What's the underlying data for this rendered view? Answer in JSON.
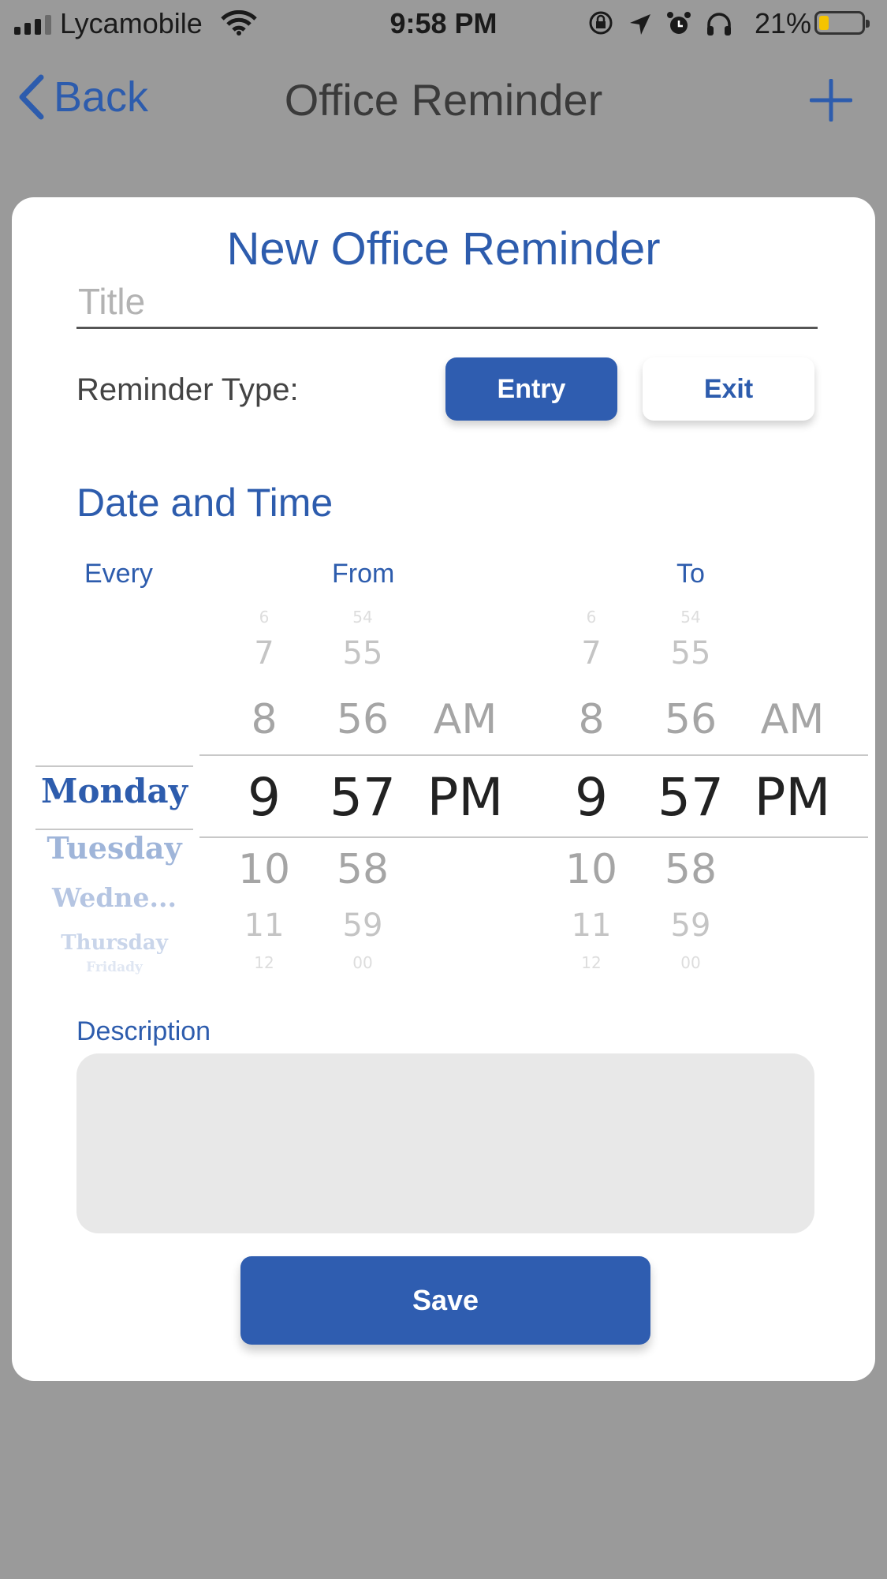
{
  "status_bar": {
    "carrier": "Lycamobile",
    "time": "9:58 PM",
    "battery": "21%"
  },
  "nav": {
    "back_label": "Back",
    "title": "Office Reminder"
  },
  "form": {
    "heading": "New Office Reminder",
    "title_placeholder": "Title",
    "reminder_type_label": "Reminder Type:",
    "entry_label": "Entry",
    "exit_label": "Exit",
    "selected_type": "Entry",
    "date_time_heading": "Date and Time",
    "every_label": "Every",
    "from_label": "From",
    "to_label": "To",
    "description_label": "Description",
    "save_label": "Save"
  },
  "every_picker": {
    "selected": "Monday",
    "below": [
      "Tuesday",
      "Wedne...",
      "Thursday",
      "Fridady"
    ]
  },
  "from_picker": {
    "hours_above": [
      "6",
      "7",
      "8"
    ],
    "hour": "9",
    "hours_below": [
      "10",
      "11",
      "12"
    ],
    "minutes_above": [
      "54",
      "55",
      "56"
    ],
    "minute": "57",
    "minutes_below": [
      "58",
      "59",
      "00"
    ],
    "ampm_above": "AM",
    "ampm": "PM"
  },
  "to_picker": {
    "hours_above": [
      "6",
      "7",
      "8"
    ],
    "hour": "9",
    "hours_below": [
      "10",
      "11",
      "12"
    ],
    "minutes_above": [
      "54",
      "55",
      "56"
    ],
    "minute": "57",
    "minutes_below": [
      "58",
      "59",
      "00"
    ],
    "ampm_above": "AM",
    "ampm": "PM"
  },
  "colors": {
    "accent": "#2f5db0",
    "overlay": "#9a9a9a",
    "description_bg": "#e8e8e8"
  }
}
